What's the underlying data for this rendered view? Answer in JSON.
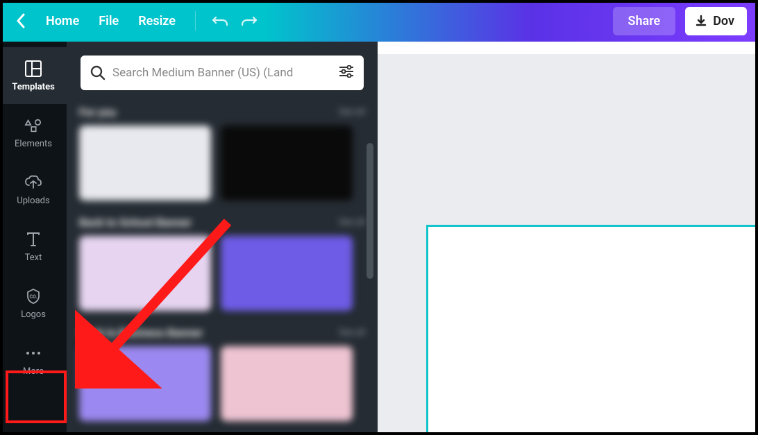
{
  "topbar": {
    "home": "Home",
    "file": "File",
    "resize": "Resize",
    "share": "Share",
    "download": "Dov"
  },
  "sidebar": {
    "items": [
      {
        "label": "Templates"
      },
      {
        "label": "Elements"
      },
      {
        "label": "Uploads"
      },
      {
        "label": "Text"
      },
      {
        "label": "Logos"
      },
      {
        "label": "More"
      }
    ]
  },
  "panel": {
    "search_placeholder": "Search Medium Banner (US) (Land",
    "sections": [
      {
        "title": "For you",
        "see_all": "See all"
      },
      {
        "title": "Back to School Banner",
        "see_all": "See all"
      },
      {
        "title": "Back to Business Banner",
        "see_all": "See all"
      }
    ]
  }
}
